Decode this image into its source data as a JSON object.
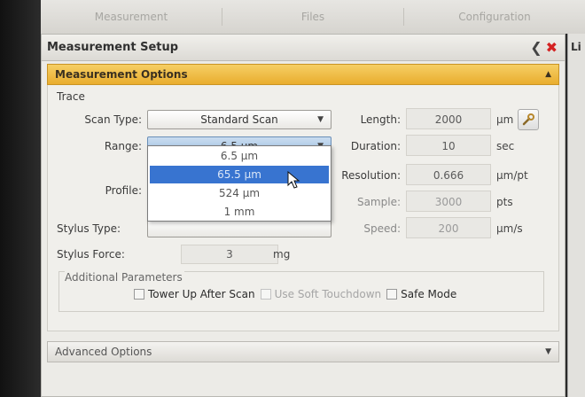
{
  "tabs": [
    "Measurement",
    "Files",
    "Configuration"
  ],
  "panel": {
    "title": "Measurement Setup",
    "right_panel_title": "Li"
  },
  "section": {
    "title": "Measurement Options",
    "group_label": "Trace"
  },
  "fields": {
    "scan_type_label": "Scan Type:",
    "scan_type_value": "Standard Scan",
    "range_label": "Range:",
    "range_value": "6.5 µm",
    "profile_label": "Profile:",
    "stylus_type_label": "Stylus Type:",
    "stylus_force_label": "Stylus Force:",
    "stylus_force_value": "3",
    "stylus_force_unit": "mg",
    "length_label": "Length:",
    "length_value": "2000",
    "length_unit": "µm",
    "duration_label": "Duration:",
    "duration_value": "10",
    "duration_unit": "sec",
    "resolution_label": "Resolution:",
    "resolution_value": "0.666",
    "resolution_unit": "µm/pt",
    "sample_label": "Sample:",
    "sample_value": "3000",
    "sample_unit": "pts",
    "speed_label": "Speed:",
    "speed_value": "200",
    "speed_unit": "µm/s"
  },
  "range_dropdown": {
    "options": [
      "6.5 µm",
      "65.5 µm",
      "524 µm",
      "1 mm"
    ],
    "selected_index": 1
  },
  "additional": {
    "title": "Additional Parameters",
    "tower_up": "Tower Up After Scan",
    "soft_touchdown": "Use Soft Touchdown",
    "safe_mode": "Safe Mode"
  },
  "advanced": {
    "title": "Advanced Options"
  },
  "icons": {
    "back": "chevron-left-icon",
    "close": "close-icon",
    "collapse": "triangle-up-icon",
    "expand": "triangle-down-icon",
    "wrench": "wrench-icon",
    "cursor": "mouse-pointer-icon"
  },
  "colors": {
    "section_header": "#e9ad2e",
    "selection": "#3874d0",
    "close": "#d42222"
  }
}
